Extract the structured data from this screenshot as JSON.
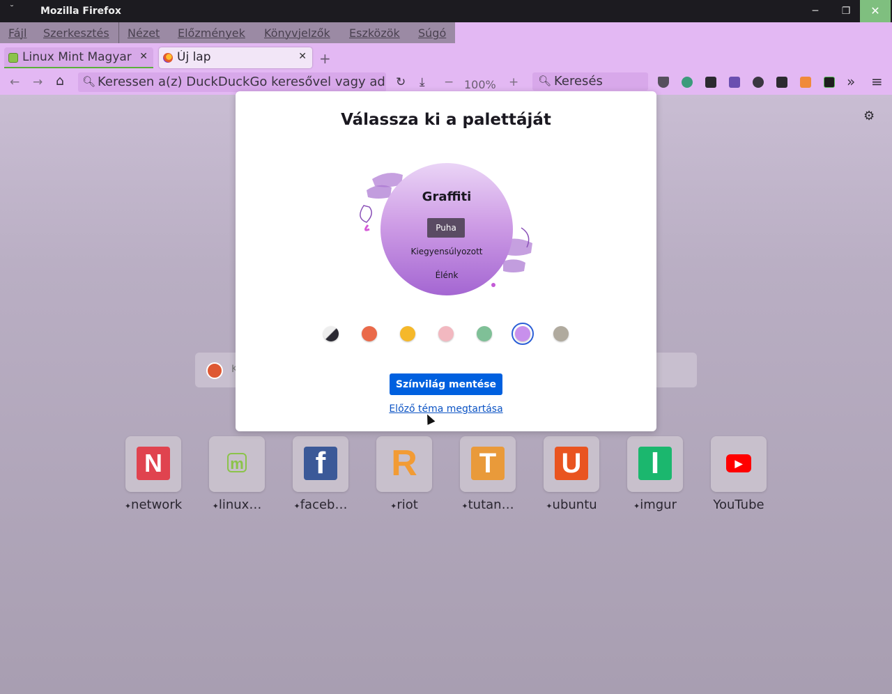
{
  "window": {
    "title": "Mozilla Firefox",
    "system_menu_glyph": "˘",
    "minimize_glyph": "─",
    "maximize_glyph": "❐",
    "close_glyph": "✕"
  },
  "menubar": {
    "items": [
      "Fájl",
      "Szerkesztés",
      "Nézet",
      "Előzmények",
      "Könyvjelzők",
      "Eszközök",
      "Súgó"
    ]
  },
  "tabs": [
    {
      "label": "Linux Mint Magyar K",
      "close_glyph": "✕"
    },
    {
      "label": "Új lap",
      "close_glyph": "✕"
    }
  ],
  "new_tab_glyph": "+",
  "navbar": {
    "back_glyph": "←",
    "forward_glyph": "→",
    "home_glyph": "⌂",
    "url_placeholder": "Keressen a(z) DuckDuckGo keresővel vagy adjo",
    "reload_glyph": "↻",
    "download_glyph": "⤓",
    "zoom_out_glyph": "−",
    "zoom_level": "100%",
    "zoom_in_glyph": "+",
    "search_placeholder": "Keresés",
    "overflow_glyph": "»",
    "hamburger_glyph": "≡"
  },
  "extensions": [
    "ublock-icon",
    "eye-icon",
    "grid-icon",
    "cube-icon",
    "spheres-icon",
    "d-icon",
    "trash-icon",
    "eh-icon"
  ],
  "newtab": {
    "settings_glyph": "⚙",
    "search_hint": "K",
    "top_sites": [
      {
        "name": "network",
        "pinned": true,
        "letter": "N",
        "color": "#e0434f"
      },
      {
        "name": "linux…",
        "pinned": true,
        "letter": "m",
        "color": "#8bc34a"
      },
      {
        "name": "faceb…",
        "pinned": true,
        "letter": "f",
        "color": "#3b5998"
      },
      {
        "name": "riot",
        "pinned": true,
        "letter": "R",
        "color": "#f29b34"
      },
      {
        "name": "tutan…",
        "pinned": true,
        "letter": "T",
        "color": "#e99a3a"
      },
      {
        "name": "ubuntu",
        "pinned": true,
        "letter": "U",
        "color": "#e95420"
      },
      {
        "name": "imgur",
        "pinned": true,
        "letter": "I",
        "color": "#1bb76e"
      },
      {
        "name": "YouTube",
        "pinned": false,
        "letter": "▶",
        "color": "#ff0000"
      }
    ],
    "pin_glyph": "✦"
  },
  "modal": {
    "heading": "Válassza ki a palettáját",
    "palette_name": "Graffiti",
    "variants": [
      "Puha",
      "Kiegyensúlyozott",
      "Élénk"
    ],
    "selected_variant": "Puha",
    "swatches": [
      {
        "name": "dark-light",
        "color": "#2b2a33"
      },
      {
        "name": "red",
        "color": "#ea6a4a"
      },
      {
        "name": "yellow",
        "color": "#f5b82a"
      },
      {
        "name": "pink",
        "color": "#f2b8c0"
      },
      {
        "name": "green",
        "color": "#7fc097"
      },
      {
        "name": "purple",
        "color": "#c890ec"
      },
      {
        "name": "gray",
        "color": "#b0aa9e"
      }
    ],
    "selected_swatch": "purple",
    "save_label": "Színvilág mentése",
    "keep_label": "Előző téma megtartása"
  }
}
